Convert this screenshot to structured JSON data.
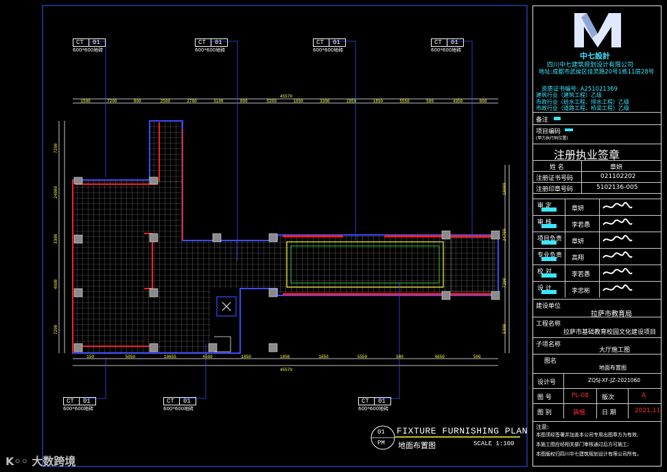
{
  "company": {
    "logo_name": "中七設計",
    "name": "四川中七建筑规划设计有限公司",
    "address": "地址:成都市武侯区佳灵路20号1栋11层28号",
    "cert": "资质证书编号: A251021369",
    "quals": [
      "建筑行业（建筑工程）乙级",
      "市政行业（给水工程、排水工程）乙级",
      "市政行业（道路工程、桥梁工程）乙级"
    ]
  },
  "notes_label": "备注",
  "project_code": {
    "label": "项目编码",
    "sub": "(甲方执行码位置)"
  },
  "seal_title": "注册执业签章",
  "registrant": {
    "name_label": "姓 名",
    "name": "章妍",
    "cert_label": "注册证书号码",
    "cert": "021102202",
    "seal_label": "注册印章号码",
    "seal": "5102136-005"
  },
  "approvals": [
    {
      "role": "审 定",
      "person": "章妍"
    },
    {
      "role": "审 核",
      "person": "李若愚"
    },
    {
      "role": "项目负责",
      "person": "章妍"
    },
    {
      "role": "专业负责",
      "person": "高翔"
    },
    {
      "role": "校 对",
      "person": "李若愚"
    },
    {
      "role": "设 计",
      "person": "李忠彬"
    }
  ],
  "client": {
    "label": "建设单位",
    "value": "拉萨市教育局"
  },
  "project_name": {
    "label": "工程名称",
    "value": "拉萨市基础教育校园文化建设项目"
  },
  "sub_item": {
    "label": "子项名称",
    "value": "大厅施工图"
  },
  "drawing_name": {
    "label": "图名",
    "value": "地面布置图"
  },
  "design_no": {
    "label": "设计号",
    "value": "ZQSJ-XF-JZ-2021060"
  },
  "drawing_no": {
    "label": "图 号",
    "value": "PL-08",
    "version_label": "版次",
    "version": "A"
  },
  "category": {
    "label": "图 别",
    "value": "装施",
    "date_label": "日 期",
    "date": "2021.11"
  },
  "footer_notes": [
    "注意:",
    "本图须经签署并加盖本公司专用出图章方为有效;",
    "本施工图应经相关部门审核通过后方可施工;",
    "本图版权归四川中七建筑规划设计有限公司所有。"
  ],
  "plan_title": {
    "num": "01",
    "unit": "PM",
    "en": "FIXTURE FURNISHING PLAN",
    "cn": "地面布置图",
    "scale": "SCALE 1:100"
  },
  "tags": [
    {
      "code": "CT",
      "num": "01",
      "spec": "600*600地砖"
    },
    {
      "code": "CT",
      "num": "01",
      "spec": "600*600地砖"
    },
    {
      "code": "CT",
      "num": "01",
      "spec": "600*600地砖"
    },
    {
      "code": "CT",
      "num": "01",
      "spec": "600*600地砖"
    },
    {
      "code": "CT",
      "num": "01",
      "spec": "600*600地砖"
    },
    {
      "code": "CT",
      "num": "01",
      "spec": "600*600地砖"
    },
    {
      "code": "CT",
      "num": "01",
      "spec": "600*600地砖"
    }
  ],
  "dims_top_total": "45570",
  "dims_top": [
    "1500",
    "7200",
    "800",
    "2500",
    "2700",
    "3100",
    "800",
    "5200",
    "1650",
    "3300",
    "1850",
    "1850",
    "5550",
    "500",
    "4950",
    "600"
  ],
  "dims_bottom_total": "45570",
  "dims_bottom": [
    "150",
    "5050",
    "10655",
    "4500",
    "1850",
    "1850",
    "1850",
    "5550",
    "500",
    "4650",
    "500"
  ],
  "dims_left": [
    "7200",
    "24000",
    "3300",
    "4600",
    "7200"
  ],
  "dims_right": [
    "10600",
    "24700",
    "7200",
    "5300"
  ],
  "watermark": "大数跨境"
}
